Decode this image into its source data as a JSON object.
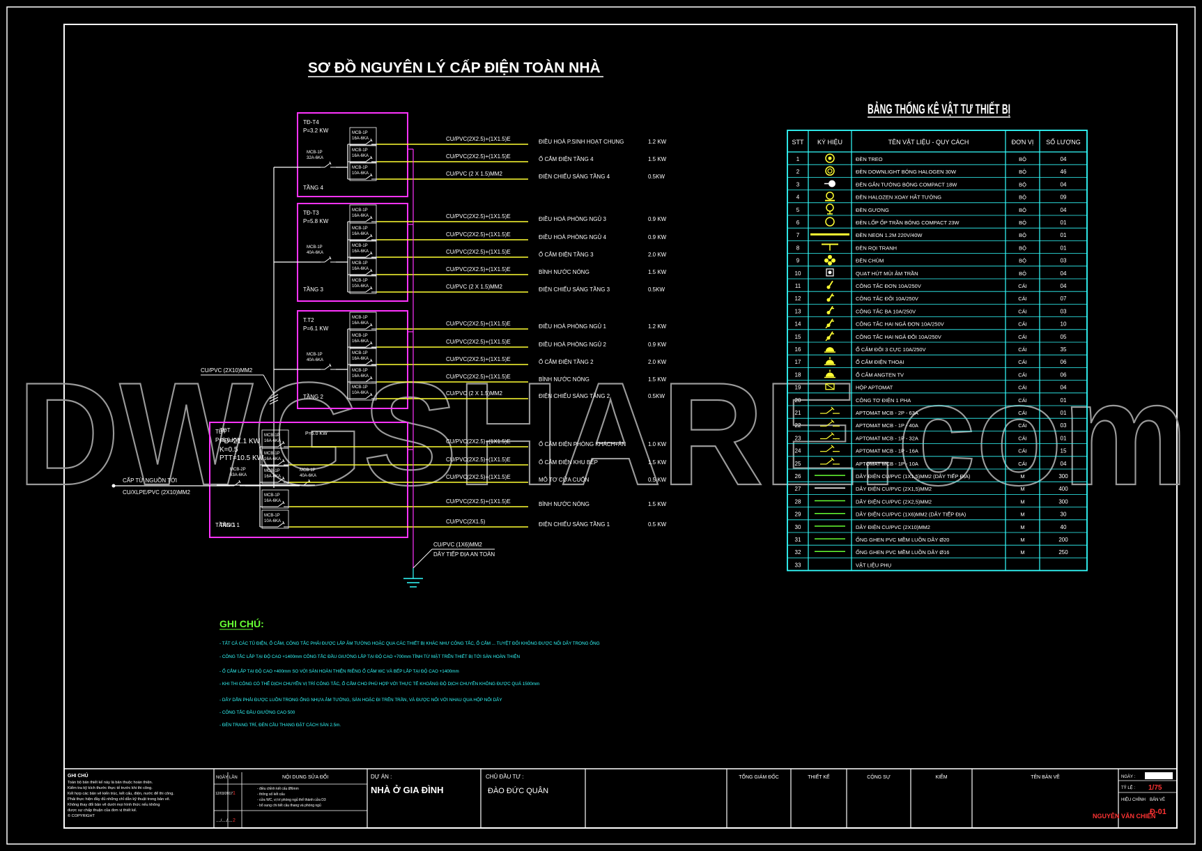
{
  "title": "SƠ ĐỒ NGUYÊN LÝ CẤP ĐIỆN TOÀN NHÀ",
  "watermark": "DWGSHARE.com",
  "colors": {
    "panel": "#ff33ff",
    "line_white": "#ffffff",
    "cable": "#ffff33",
    "table": "#33ffff",
    "note": "#66ff33"
  },
  "panels": [
    {
      "name": "TĐ-T4",
      "power": "P=3.2 KW",
      "main_mcb": [
        "MCB-1P",
        "32A-6KA"
      ],
      "floor": "TẦNG 4",
      "circuits": [
        {
          "mcb": [
            "MCB-1P",
            "16A-6KA"
          ],
          "cable": "CU/PVC(2X2.5)+(1X1.5)E",
          "load": "ĐIỀU HOÀ P.SINH HOẠT CHUNG",
          "power": "1.2 KW"
        },
        {
          "mcb": [
            "MCB-1P",
            "16A-6KA"
          ],
          "cable": "CU/PVC(2X2.5)+(1X1.5)E",
          "load": "Ổ CẮM ĐIỆN TẦNG 4",
          "power": "1.5 KW"
        },
        {
          "mcb": [
            "MCB-1P",
            "10A-6KA"
          ],
          "cable": "CU/PVC (2 X 1.5)MM2",
          "load": "ĐIỆN CHIẾU SÁNG TẦNG 4",
          "power": "0.5KW"
        }
      ]
    },
    {
      "name": "TĐ-T3",
      "power": "P=5.8 KW",
      "main_mcb": [
        "MCB-1P",
        "40A-6KA"
      ],
      "floor": "TẦNG 3",
      "circuits": [
        {
          "mcb": [
            "MCB-1P",
            "16A-6KA"
          ],
          "cable": "CU/PVC(2X2.5)+(1X1.5)E",
          "load": "ĐIỀU HOÀ PHÒNG NGỦ 3",
          "power": "0.9 KW"
        },
        {
          "mcb": [
            "MCB-1P",
            "16A-6KA"
          ],
          "cable": "CU/PVC(2X2.5)+(1X1.5)E",
          "load": "ĐIỀU HOÀ PHÒNG NGỦ 4",
          "power": "0.9 KW"
        },
        {
          "mcb": [
            "MCB-1P",
            "16A-6KA"
          ],
          "cable": "CU/PVC(2X2.5)+(1X1.5)E",
          "load": "Ổ CẮM ĐIỆN TẦNG 3",
          "power": "2.0 KW"
        },
        {
          "mcb": [
            "MCB-1P",
            "16A-6KA"
          ],
          "cable": "CU/PVC(2X2.5)+(1X1.5)E",
          "load": "BÌNH NƯỚC NÓNG",
          "power": "1.5 KW"
        },
        {
          "mcb": [
            "MCB-1P",
            "10A-6KA"
          ],
          "cable": "CU/PVC (2 X 1.5)MM2",
          "load": "ĐIỆN CHIẾU SÁNG TẦNG 3",
          "power": "0.5KW"
        }
      ]
    },
    {
      "name": "T.T2",
      "power": "P=6.1 KW",
      "main_mcb": [
        "MCB-1P",
        "40A-6KA"
      ],
      "floor": "TẦNG 2",
      "circuits": [
        {
          "mcb": [
            "MCB-1P",
            "16A-6KA"
          ],
          "cable": "CU/PVC(2X2.5)+(1X1.5)E",
          "load": "ĐIỀU HOÀ PHÒNG NGỦ 1",
          "power": "1.2 KW"
        },
        {
          "mcb": [
            "MCB-1P",
            "16A-6KA"
          ],
          "cable": "CU/PVC(2X2.5)+(1X1.5)E",
          "load": "ĐIỀU HOÀ PHÒNG NGỦ 2",
          "power": "0.9 KW"
        },
        {
          "mcb": [
            "MCB-1P",
            "16A-6KA"
          ],
          "cable": "CU/PVC(2X2.5)+(1X1.5)E",
          "load": "Ổ CẮM ĐIỆN TẦNG 2",
          "power": "2.0 KW"
        },
        {
          "mcb": [
            "MCB-1P",
            "16A-6KA"
          ],
          "cable": "CU/PVC(2X2.5)+(1X1.5)E",
          "load": "BÌNH NƯỚC NÓNG",
          "power": "1.5 KW"
        },
        {
          "mcb": [
            "MCB-1P",
            "10A-6KA"
          ],
          "cable": "CU/PVC (2 X 1.5)MM2",
          "load": "ĐIỆN CHIẾU SÁNG TẦNG 2",
          "power": "0.5KW"
        }
      ]
    },
    {
      "name": "TĐT",
      "power": "P=5.0 KW",
      "main_mcb": [
        "MCB-1P",
        "40A-6KA"
      ],
      "floor": "TẦNG 1",
      "stats": [
        "PĐ=21.1 KW",
        "K=0.5",
        "PTT=10.5 KW"
      ],
      "total_mcb": [
        "MCB-2P",
        "63A-6KA"
      ],
      "circuits": [
        {
          "mcb": [
            "MCB-1P",
            "16A-6KA"
          ],
          "cable": "CU/PVC(2X2.5)+(1X1.5)E",
          "load": "Ổ CẮM ĐIỆN PHÒNG KHÁCH+ĂN",
          "power": "1.0 KW"
        },
        {
          "mcb": [
            "MCB-1P",
            "16A-6KA"
          ],
          "cable": "CU/PVC(2X2.5)+(1X1.5)E",
          "load": "Ổ CẮM ĐIỆN KHU BẾP",
          "power": "1.5 KW"
        },
        {
          "mcb": [
            "MCB-1P",
            "16A-6KA"
          ],
          "cable": "CU/PVC(2X2.5)+(1X1.5)E",
          "load": "MÔ TƠ CỬA CUỐN",
          "power": "0.5 KW"
        },
        {
          "mcb": [
            "MCB-1P",
            "16A-6KA"
          ],
          "cable": "CU/PVC(2X2.5)+(1X1.5)E",
          "load": "BÌNH NƯỚC NÓNG",
          "power": "1.5 KW"
        },
        {
          "mcb": [
            "MCB-1P",
            "10A-6KA"
          ],
          "cable": "CU/PVC(2X1.5)",
          "load": "ĐIỆN CHIẾU SÁNG TẦNG 1",
          "power": "0.5 KW"
        }
      ]
    }
  ],
  "riser_cable": "CU/PVC (2X10)MM2",
  "source_labels": [
    "CẤP TỪ NGUỒN TỚI",
    "CU/XLPE/PVC (2X10)MM2"
  ],
  "ground_labels": [
    "CU/PVC (1X6)MM2",
    "DÂY TIẾP ĐỊA AN TOÀN"
  ],
  "notes": {
    "title": "GHI CHÚ:",
    "items": [
      "- TẤT CẢ CÁC TỦ ĐIỆN, Ổ CẮM, CÔNG TẮC PHẢI ĐƯỢC LẮP ÂM TƯỜNG HOẶC QUA CÁC THIẾT BỊ KHÁC NHƯ CÔNG TẮC, Ổ CẮM ... TUYỆT ĐỐI KHÔNG ĐƯỢC NỐI DÂY TRONG ỐNG",
      "- CÔNG TẮC LẮP TẠI ĐỘ CAO +1400mm CÔNG TẮC ĐẦU GIƯỜNG LẮP TẠI ĐỘ CAO +700mm TÍNH TỪ MẶT TRÊN THIẾT BỊ TỚI SÀN HOÀN THIỆN",
      "- Ổ CẮM LẮP TẠI ĐỘ CAO +400mm SO VỚI SÀN HOÀN THIỆN RIÊNG Ổ CẮM WC VÀ BẾP LẮP TẠI ĐỘ CAO +1400mm",
      "- KHI THI CÔNG CÓ THỂ DỊCH CHUYỂN VỊ TRÍ CÔNG TẮC, Ổ CẮM CHO PHÙ HỢP VỚI THỰC TẾ KHOẢNG ĐỘ DỊCH CHUYỂN KHÔNG ĐƯỢC QUÁ 1500mm",
      "- DÂY DẪN PHẢI ĐƯỢC LUỒN TRONG ỐNG NHỰA ÂM TƯỜNG, SÀN HOẶC ĐI TRÊN TRẦN, VÀ ĐƯỢC NỐI VỚI NHAU QUA HỘP NỐI DÂY",
      "- CÔNG TẮC ĐẦU GIƯỜNG CAO 500",
      "- ĐÈN TRANG TRÍ, ĐÈN CẦU THANG ĐẶT CÁCH SÀN 2.5m."
    ]
  },
  "bom": {
    "title": "BẢNG THỐNG KÊ VẬT TƯ THIẾT BỊ",
    "headers": [
      "STT",
      "KÝ HIỆU",
      "TÊN VẬT LIỆU - QUY CÁCH",
      "ĐƠN VỊ",
      "SỐ LƯỢNG"
    ],
    "rows": [
      {
        "stt": "1",
        "icon": "pendant-lamp-icon",
        "name": "ĐÈN TREO",
        "unit": "BỘ",
        "qty": "04"
      },
      {
        "stt": "2",
        "icon": "downlight-icon",
        "name": "ĐÈN DOWNLIGHT BÓNG HALOGEN 30W",
        "unit": "BỘ",
        "qty": "46"
      },
      {
        "stt": "3",
        "icon": "wall-lamp-icon",
        "name": "ĐÈN GẮN TƯỜNG BÓNG COMPACT 18W",
        "unit": "BỘ",
        "qty": "04"
      },
      {
        "stt": "4",
        "icon": "halogen-spot-icon",
        "name": "ĐÈN HALOZEN XOAY HẮT TƯỜNG",
        "unit": "BỘ",
        "qty": "09"
      },
      {
        "stt": "5",
        "icon": "mirror-lamp-icon",
        "name": "ĐÈN GƯƠNG",
        "unit": "BỘ",
        "qty": "04"
      },
      {
        "stt": "6",
        "icon": "ceiling-lamp-icon",
        "name": "ĐÈN LỐP ỐP TRẦN BÓNG COMPACT 23W",
        "unit": "BỘ",
        "qty": "01"
      },
      {
        "stt": "7",
        "icon": "neon-tube-icon",
        "name": "ĐÈN NEON 1.2M 220V/40W",
        "unit": "BỘ",
        "qty": "01"
      },
      {
        "stt": "8",
        "icon": "picture-lamp-icon",
        "name": "ĐÈN RỌI TRANH",
        "unit": "BỘ",
        "qty": "01"
      },
      {
        "stt": "9",
        "icon": "chandelier-icon",
        "name": "ĐÈN CHÙM",
        "unit": "BỘ",
        "qty": "03"
      },
      {
        "stt": "10",
        "icon": "exhaust-fan-icon",
        "name": "QUẠT HÚT MÙI ÂM TRẦN",
        "unit": "BỘ",
        "qty": "04"
      },
      {
        "stt": "11",
        "icon": "switch-single-icon",
        "name": "CÔNG TẮC ĐƠN 10A/250V",
        "unit": "CÁI",
        "qty": "04"
      },
      {
        "stt": "12",
        "icon": "switch-double-icon",
        "name": "CÔNG TẮC ĐÔI 10A/250V",
        "unit": "CÁI",
        "qty": "07"
      },
      {
        "stt": "13",
        "icon": "switch-triple-icon",
        "name": "CÔNG TẮC BA 10A/250V",
        "unit": "CÁI",
        "qty": "03"
      },
      {
        "stt": "14",
        "icon": "switch-2way-single-icon",
        "name": "CÔNG TẮC HAI NGẢ ĐƠN 10A/250V",
        "unit": "CÁI",
        "qty": "10"
      },
      {
        "stt": "15",
        "icon": "switch-2way-double-icon",
        "name": "CÔNG TẮC HAI NGẢ ĐÔI 10A/250V",
        "unit": "CÁI",
        "qty": "05"
      },
      {
        "stt": "16",
        "icon": "socket-icon",
        "name": "Ổ CẮM ĐÔI 3 CỰC 10A/250V",
        "unit": "CÁI",
        "qty": "35"
      },
      {
        "stt": "17",
        "icon": "phone-outlet-icon",
        "name": "Ổ CẮM ĐIỆN THOẠI",
        "unit": "CÁI",
        "qty": "06"
      },
      {
        "stt": "18",
        "icon": "tv-outlet-icon",
        "name": "Ổ CẮM ANGTEN TV",
        "unit": "CÁI",
        "qty": "06"
      },
      {
        "stt": "19",
        "icon": "breaker-box-icon",
        "name": "HỘP APTOMAT",
        "unit": "CÁI",
        "qty": "04"
      },
      {
        "stt": "20",
        "icon": "",
        "name": "CÔNG TƠ ĐIỆN 1 PHA",
        "unit": "CÁI",
        "qty": "01"
      },
      {
        "stt": "21",
        "icon": "breaker-icon",
        "name": "APTOMAT MCB - 2P - 63A",
        "unit": "CÁI",
        "qty": "01"
      },
      {
        "stt": "22",
        "icon": "breaker-icon",
        "name": "APTOMAT MCB - 1P - 40A",
        "unit": "CÁI",
        "qty": "03"
      },
      {
        "stt": "23",
        "icon": "breaker-icon",
        "name": "APTOMAT MCB - 1P - 32A",
        "unit": "CÁI",
        "qty": "01"
      },
      {
        "stt": "24",
        "icon": "breaker-icon",
        "name": "APTOMAT MCB - 1P - 16A",
        "unit": "CÁI",
        "qty": "15"
      },
      {
        "stt": "25",
        "icon": "breaker-icon",
        "name": "APTOMAT MCB - 1P - 10A",
        "unit": "CÁI",
        "qty": "04"
      },
      {
        "stt": "26",
        "icon": "wire-green-icon",
        "name": "DÂY ĐIỆN CU/PVC (1X1,5)MM2 (DÂY TIẾP ĐỊA)",
        "unit": "M",
        "qty": "300"
      },
      {
        "stt": "27",
        "icon": "wire-white-icon",
        "name": "DÂY ĐIỆN CU/PVC (2X1,5)MM2",
        "unit": "M",
        "qty": "400"
      },
      {
        "stt": "28",
        "icon": "wire-green-icon",
        "name": "DÂY ĐIỆN CU/PVC (2X2,5)MM2",
        "unit": "M",
        "qty": "300"
      },
      {
        "stt": "29",
        "icon": "wire-green-icon",
        "name": "DÂY ĐIỆN CU/PVC (1X6)MM2 (DÂY TIẾP ĐỊA)",
        "unit": "M",
        "qty": "30"
      },
      {
        "stt": "30",
        "icon": "wire-green-icon",
        "name": "DÂY ĐIỆN CU/PVC (2X10)MM2",
        "unit": "M",
        "qty": "40"
      },
      {
        "stt": "31",
        "icon": "wire-green-icon",
        "name": "ỐNG GHEN PVC MỀM LUỒN DÂY Ø20",
        "unit": "M",
        "qty": "200"
      },
      {
        "stt": "32",
        "icon": "wire-green-icon",
        "name": "ỐNG GHEN PVC MỀM LUỒN DÂY Ø16",
        "unit": "M",
        "qty": "250"
      },
      {
        "stt": "33",
        "icon": "",
        "name": "VẬT LIỆU PHỤ",
        "unit": "",
        "qty": ""
      }
    ]
  },
  "titleblock": {
    "note_title": "GHI CHÚ",
    "note_lines": [
      "Toàn bộ bản thiết kế này là bản thuộc hoàn thiện.",
      "Kiểm tra kỹ kích thước thực tế trước khi thi công.",
      "Kết hợp các bản vẽ kiến trúc, kết cấu, điện, nước để thi công.",
      "Phải thực hiện đầy đủ những chỉ dẫn kỹ thuật trong bản vẽ.",
      "Không thay đổi bản vẽ dưới mọi hình thức nếu không",
      "được sự chấp thuận của đơn vị thiết kế.",
      "© COPYRIGHT"
    ],
    "rev_headers": [
      "NGÀY",
      "LẦN",
      "NỘI DUNG SỬA ĐỔI"
    ],
    "rev1_date": "12/03/2017",
    "rev1_no": "1",
    "rev1_lines": [
      "- điều chỉnh kết cấu Ø6mm",
      "- thông số kết cấu",
      "- cửa WC, vị trí phòng ngủ thể thành cửa D3",
      "- bổ sung chi tiết cầu thang và phòng ngủ"
    ],
    "rev2_date": "..../..../....",
    "rev2_no": "2",
    "project_label": "DỰ ÁN :",
    "project_name": "NHÀ Ở GIA ĐÌNH",
    "owner_label": "CHỦ ĐẦU TƯ :",
    "owner_name": "ĐÀO ĐỨC QUÂN",
    "sign_headers": [
      "TỔNG GIÁM ĐỐC",
      "THIẾT KẾ",
      "CỘNG SỰ",
      "KIỂM"
    ],
    "drawing_name_label": "TÊN BẢN VẼ",
    "date_label": "NGÀY :",
    "scale_label": "TỶ LỆ :",
    "scale_value": "1/75",
    "chief_label": "HIỆU CHỈNH",
    "sheet_label": "BẢN VẼ",
    "sheet_value": "Đ-01",
    "author": "NGUYỄN VĂN CHIẾN"
  }
}
